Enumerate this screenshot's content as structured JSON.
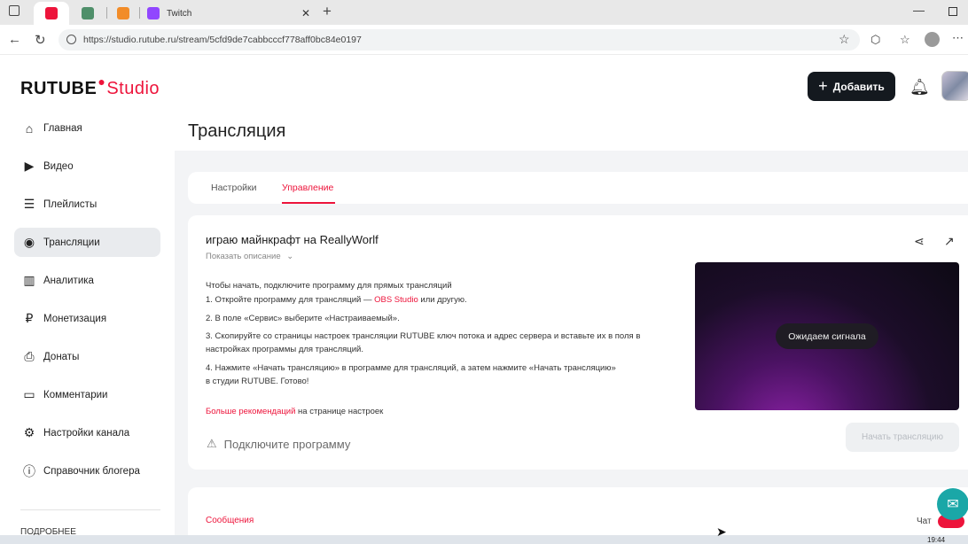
{
  "browser": {
    "tabs": [
      {
        "title": ""
      },
      {
        "title": ""
      },
      {
        "title": ""
      },
      {
        "title": "Twitch"
      }
    ],
    "url": "https://studio.rutube.ru/stream/5cfd9de7cabbcccf778aff0bc84e0197"
  },
  "logo": {
    "brand": "RUTUBE",
    "suffix": "Studio"
  },
  "header": {
    "add_label": "Добавить"
  },
  "sidebar": {
    "items": [
      {
        "label": "Главная",
        "icon": "home-icon"
      },
      {
        "label": "Видео",
        "icon": "video-icon"
      },
      {
        "label": "Плейлисты",
        "icon": "playlist-icon"
      },
      {
        "label": "Трансляции",
        "icon": "broadcast-icon"
      },
      {
        "label": "Аналитика",
        "icon": "analytics-icon"
      },
      {
        "label": "Монетизация",
        "icon": "ruble-icon"
      },
      {
        "label": "Донаты",
        "icon": "donate-icon"
      },
      {
        "label": "Комментарии",
        "icon": "comment-icon"
      },
      {
        "label": "Настройки канала",
        "icon": "gear-icon"
      },
      {
        "label": "Справочник блогера",
        "icon": "info-icon"
      }
    ],
    "more_label": "ПОДРОБНЕЕ"
  },
  "page": {
    "title": "Трансляция",
    "tabs": [
      {
        "label": "Настройки"
      },
      {
        "label": "Управление"
      }
    ]
  },
  "stream": {
    "title": "играю майнкрафт на ReallyWorlf",
    "show_description": "Показать описание",
    "instructions_heading": "Чтобы начать, подключите программу для прямых трансляций",
    "step1_prefix": "1. Откройте программу для трансляций — ",
    "step1_link": "OBS Studio",
    "step1_suffix": " или другую.",
    "step2": "2. В поле «Сервис» выберите «Настраиваемый».",
    "step3": "3. Скопируйте со страницы настроек трансляции RUTUBE ключ потока и адрес сервера и вставьте их в поля в настройках программы для трансляций.",
    "step4": "4. Нажмите «Начать трансляцию» в программе для трансляций, а затем нажмите «Начать трансляцию» в студии RUTUBE. Готово!",
    "more_link": "Больше рекомендаций",
    "more_suffix": " на странице настроек",
    "waiting_signal": "Ожидаем сигнала",
    "connect_warning": "Подключите программу",
    "start_button": "Начать трансляцию"
  },
  "messages": {
    "label": "Сообщения",
    "chat_label": "Чат"
  },
  "taskbar": {
    "time": "19:44"
  },
  "colors": {
    "accent": "#ed143b",
    "dark_button": "#14191f"
  }
}
